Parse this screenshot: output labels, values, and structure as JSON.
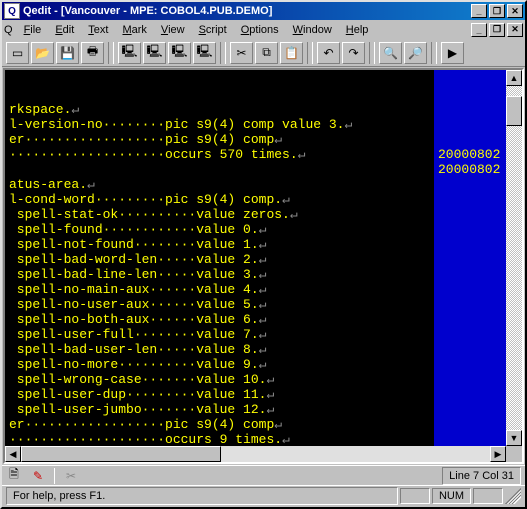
{
  "titlebar": {
    "icon_label": "Q",
    "title": "Qedit - [Vancouver - MPE: COBOL4.PUB.DEMO]",
    "min": "_",
    "max": "❐",
    "close": "✕"
  },
  "menubar": {
    "items": [
      {
        "label": "File",
        "u": "F"
      },
      {
        "label": "Edit",
        "u": "E"
      },
      {
        "label": "Text",
        "u": "T"
      },
      {
        "label": "Mark",
        "u": "M"
      },
      {
        "label": "View",
        "u": "V"
      },
      {
        "label": "Script",
        "u": "S"
      },
      {
        "label": "Options",
        "u": "O"
      },
      {
        "label": "Window",
        "u": "W"
      },
      {
        "label": "Help",
        "u": "H"
      }
    ],
    "doc_min": "_",
    "doc_max": "❐",
    "doc_close": "✕"
  },
  "toolbar": {
    "buttons": [
      {
        "name": "new-icon",
        "glyph": "▭"
      },
      {
        "name": "open-icon",
        "glyph": "📂"
      },
      {
        "name": "save-icon",
        "glyph": "💾"
      },
      {
        "name": "print-icon",
        "glyph": "🖶"
      },
      {
        "sep": true
      },
      {
        "name": "host-icon",
        "glyph": "🖳"
      },
      {
        "name": "host-open-icon",
        "glyph": "🖳"
      },
      {
        "name": "host-save-icon",
        "glyph": "🖳"
      },
      {
        "name": "host-list-icon",
        "glyph": "🖳"
      },
      {
        "sep": true
      },
      {
        "name": "cut-icon",
        "glyph": "✂"
      },
      {
        "name": "copy-icon",
        "glyph": "⧉"
      },
      {
        "name": "paste-icon",
        "glyph": "📋"
      },
      {
        "sep": true
      },
      {
        "name": "undo-icon",
        "glyph": "↶"
      },
      {
        "name": "redo-icon",
        "glyph": "↷"
      },
      {
        "sep": true
      },
      {
        "name": "find-icon",
        "glyph": "🔍"
      },
      {
        "name": "find-next-icon",
        "glyph": "🔎"
      },
      {
        "sep": true
      },
      {
        "name": "compile-icon",
        "glyph": "▶"
      }
    ]
  },
  "editor": {
    "lines": [
      "rkspace.",
      "l-version-no        pic s9(4) comp value 3.",
      "er                  pic s9(4) comp",
      "                    occurs 570 times.",
      "",
      "atus-area.",
      "l-cond-word         pic s9(4) comp.",
      " spell-stat-ok          value zeros.",
      " spell-found            value 0.",
      " spell-not-found        value 1.",
      " spell-bad-word-len     value 2.",
      " spell-bad-line-len     value 3.",
      " spell-no-main-aux      value 4.",
      " spell-no-user-aux      value 5.",
      " spell-no-both-aux      value 6.",
      " spell-user-full        value 7.",
      " spell-bad-user-len     value 8.",
      " spell-no-more          value 9.",
      " spell-wrong-case       value 10.",
      " spell-user-dup         value 11.",
      " spell-user-jumbo       value 12.",
      "er                  pic s9(4) comp",
      "                    occurs 9 times."
    ],
    "gutter": [
      "",
      "",
      "",
      "",
      "",
      "20000802",
      "20000802",
      "",
      "",
      "",
      "",
      "",
      "",
      "",
      "",
      "",
      "",
      "",
      "",
      "",
      "",
      "",
      ""
    ]
  },
  "iconbar": {
    "document_glyph": "🗎",
    "pencil_glyph": "✎",
    "scissors_glyph": "✂",
    "position": "Line 7 Col 31"
  },
  "statusbar": {
    "help": "For help, press F1.",
    "num": "NUM"
  },
  "colors": {
    "editor_bg": "#000000",
    "editor_fg": "#ffff00",
    "gutter_bg": "#0000cd",
    "title_gradient_start": "#000080",
    "title_gradient_end": "#1084d0",
    "chrome": "#c0c0c0"
  }
}
